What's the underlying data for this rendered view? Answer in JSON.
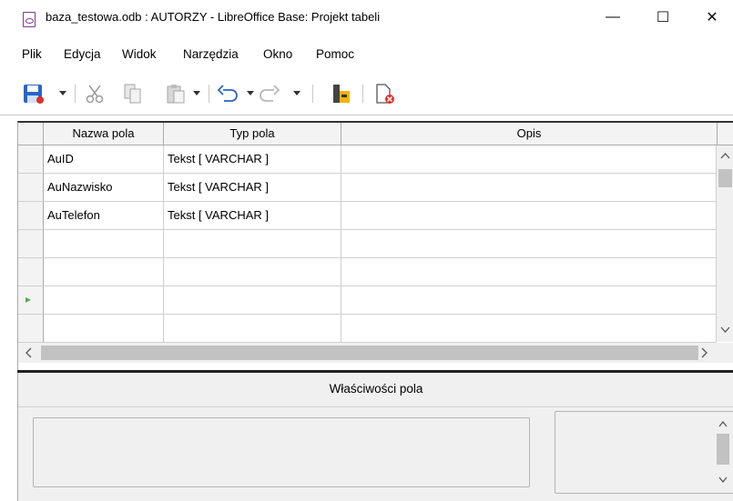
{
  "window": {
    "title": "baza_testowa.odb : AUTORZY - LibreOffice Base: Projekt tabeli",
    "minimize": "—",
    "maximize": "☐",
    "close": "✕"
  },
  "menu": [
    "Plik",
    "Edycja",
    "Widok",
    "Narzędzia",
    "Okno",
    "Pomoc"
  ],
  "grid": {
    "headers": [
      "Nazwa pola",
      "Typ pola",
      "Opis"
    ],
    "rows": [
      {
        "name": "AuID",
        "type": "Tekst [ VARCHAR ]",
        "desc": ""
      },
      {
        "name": "AuNazwisko",
        "type": "Tekst [ VARCHAR ]",
        "desc": ""
      },
      {
        "name": "AuTelefon",
        "type": "Tekst [ VARCHAR ]",
        "desc": ""
      },
      {
        "name": "",
        "type": "",
        "desc": ""
      },
      {
        "name": "",
        "type": "",
        "desc": ""
      },
      {
        "name": "",
        "type": "",
        "desc": ""
      },
      {
        "name": "",
        "type": "",
        "desc": ""
      }
    ],
    "current_row_marker": "▸"
  },
  "properties": {
    "title": "Właściwości pola"
  },
  "colors": {
    "save_blue": "#2a64c8",
    "save_red": "#e0302a",
    "marker_green": "#4caf50",
    "app_purple": "#7a3b8f"
  }
}
